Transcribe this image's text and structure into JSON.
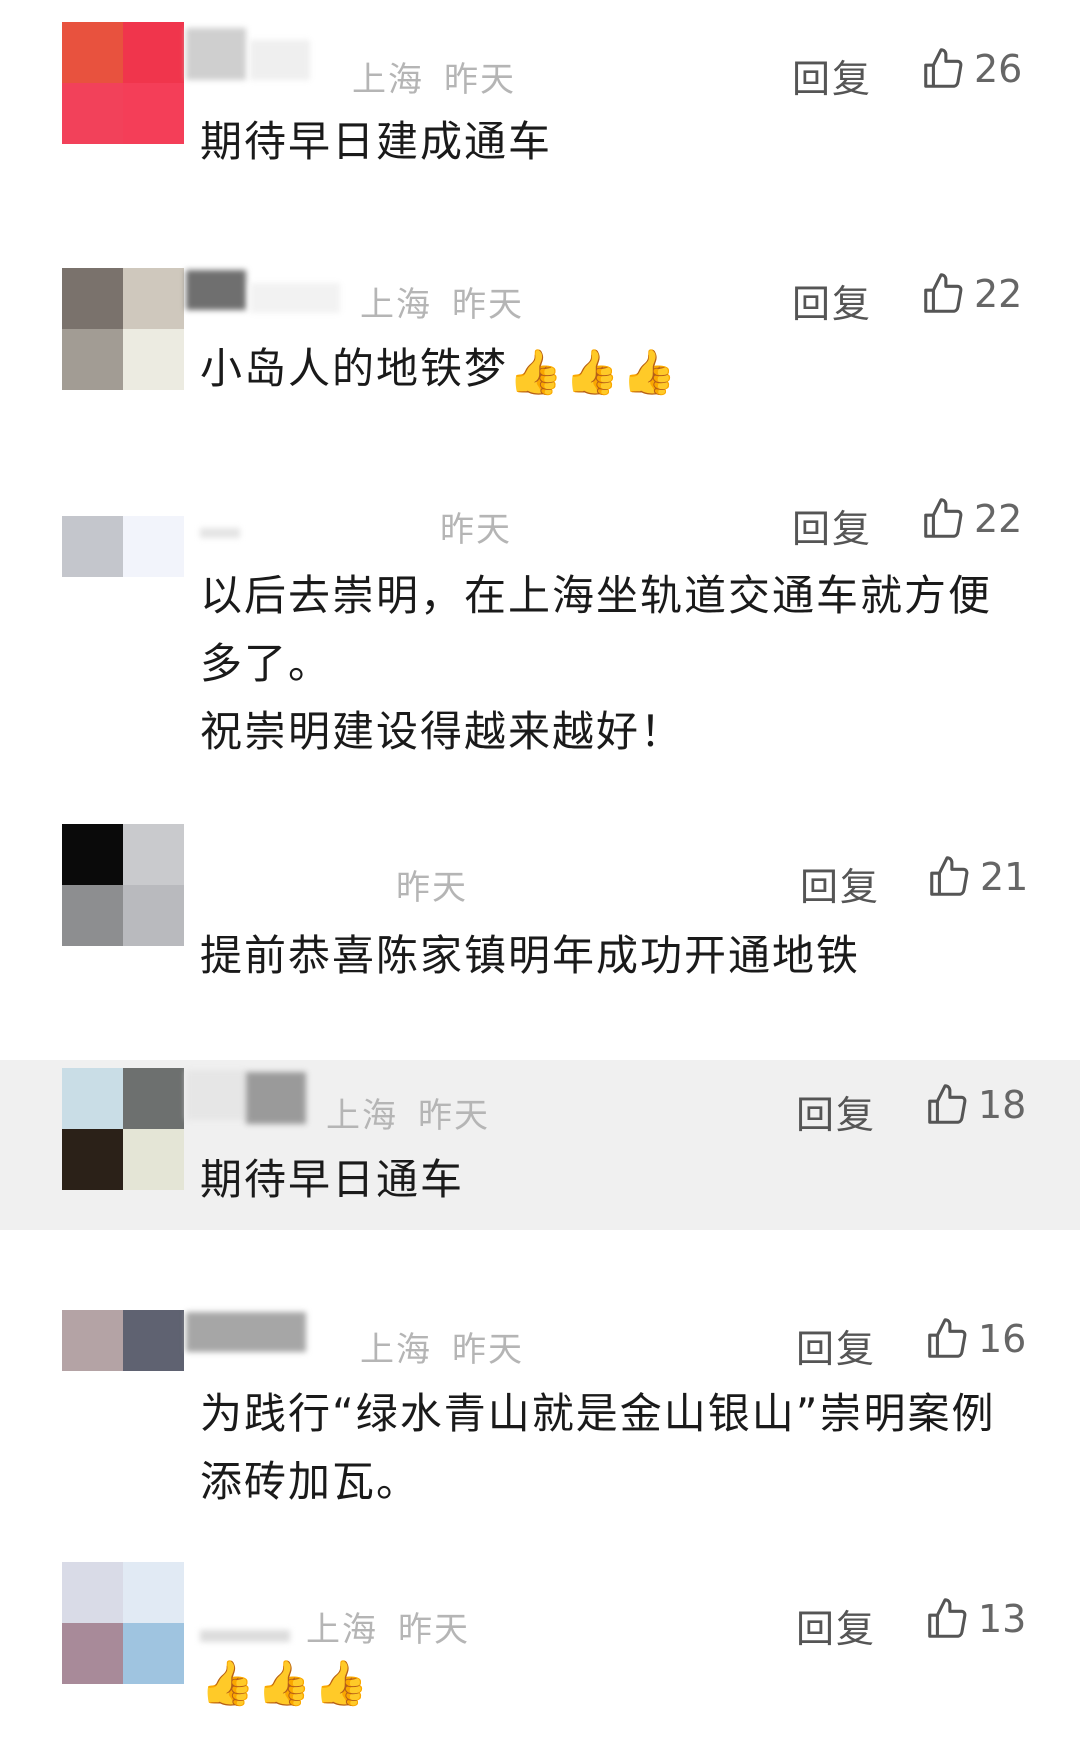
{
  "comments": [
    {
      "location": "上海",
      "time": "昨天",
      "reply_label": "回复",
      "likes": "26",
      "text_lines": [
        "期待早日建成通车"
      ],
      "avatar_colors": [
        "#e8523e",
        "#f0354c",
        "#f2415a",
        "#f43e58"
      ]
    },
    {
      "location": "上海",
      "time": "昨天",
      "reply_label": "回复",
      "likes": "22",
      "text": "小岛人的地铁梦",
      "emoji": "👍👍👍",
      "avatar_colors": [
        "#7a726c",
        "#cfc8bd",
        "#a29c94",
        "#ecebe1"
      ]
    },
    {
      "time": "昨天",
      "reply_label": "回复",
      "likes": "22",
      "text_lines": [
        "以后去崇明，在上海坐轨道交通车就方便",
        "多了。",
        "祝崇明建设得越来越好！"
      ],
      "avatar_colors": [
        "#c4c6cc",
        "#f2f4fb",
        "#ffffff",
        "#ffffff"
      ]
    },
    {
      "time": "昨天",
      "reply_label": "回复",
      "likes": "21",
      "text_lines": [
        "提前恭喜陈家镇明年成功开通地铁"
      ],
      "avatar_colors": [
        "#0a0a0a",
        "#c9cacd",
        "#8d8e90",
        "#b9babe"
      ]
    },
    {
      "location": "上海",
      "time": "昨天",
      "reply_label": "回复",
      "likes": "18",
      "text_lines": [
        "期待早日通车"
      ],
      "avatar_colors": [
        "#c9dde6",
        "#6d706f",
        "#2b2118",
        "#e4e5d6"
      ]
    },
    {
      "location": "上海",
      "time": "昨天",
      "reply_label": "回复",
      "likes": "16",
      "text_lines": [
        "为践行“绿水青山就是金山银山”崇明案例",
        "添砖加瓦。"
      ],
      "avatar_colors": [
        "#b4a3a5",
        "#5f6271",
        "#ffffff",
        "#ffffff"
      ]
    },
    {
      "location": "上海",
      "time": "昨天",
      "reply_label": "回复",
      "likes": "13",
      "emoji": "👍👍👍",
      "avatar_colors": [
        "#d9dbe7",
        "#e1eaf4",
        "#a88a99",
        "#9fc4e0"
      ]
    }
  ]
}
